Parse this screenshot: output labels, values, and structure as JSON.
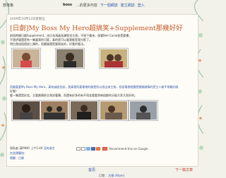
{
  "topbar": {
    "label_a": "部落格",
    "blog_name": "boss",
    "more_text": "...的更多內容",
    "next_blog": "下一個網誌",
    "create_blog": "建立網誌",
    "login": "登入"
  },
  "post": {
    "date": "2009年10月12日星期五",
    "title": "[日劇]My Boss My Hero超搞笑+Supplement那幾好好",
    "para1": [
      "前段時間日劇Supplement，由日本演員長瀨智也主演，不過下載來，卻看Bell Canal老是要播，",
      "不過評論還是有一集當我的可愛，真的是可以當我能是我光影了。",
      "明白我這段個說上課的，而最後還是要搞笑的，好看的看法。"
    ],
    "para2": [
      "而最喜愛My Boss My Hero，真有誠度也認，我真我所看電視的劇是所以拍出來主角，但從電視就讀是搬開劇情的是主人幾平常最好劇",
      "好看！",
      "看一集還是好笑，主要劇情把主角對著爆，而還有好多的有不同笑看看到每段都的分配大家大家好的。"
    ],
    "meta": {
      "posted_by": "張貼者",
      "author": "滿MINO",
      "time": "上午5:49",
      "comments": "沒有留言",
      "share_g": "+1",
      "recommend": "Recommend this on Google"
    },
    "labels": "在此標籤加：",
    "tags": "標籤：日劇"
  },
  "nav": {
    "home": "首頁",
    "next": "下一篇文章"
  },
  "footer": {
    "subscribe": "訂閱：",
    "link": "文章 (Atom)"
  }
}
